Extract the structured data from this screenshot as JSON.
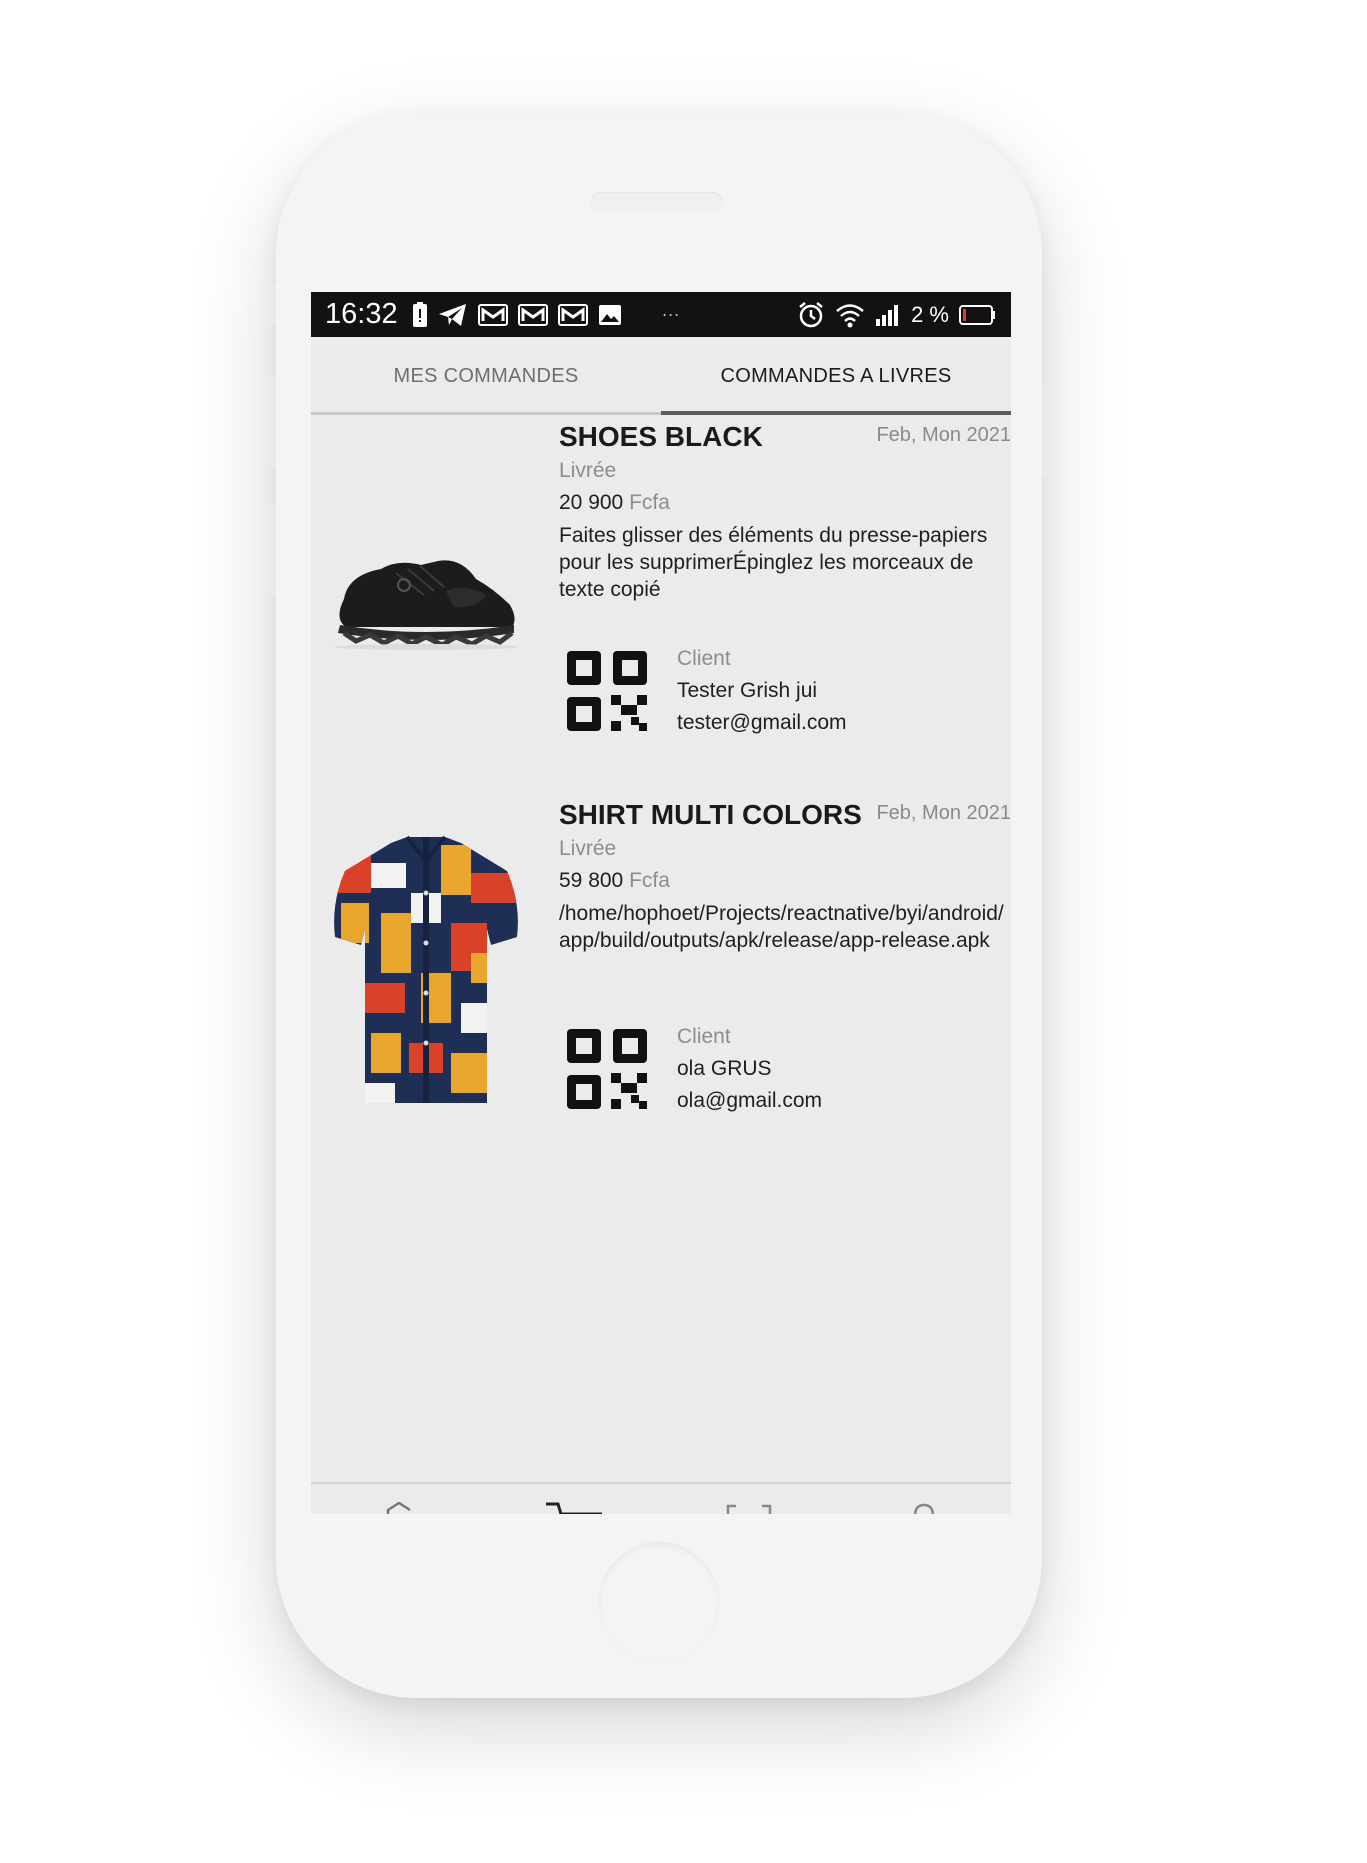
{
  "statusbar": {
    "time": "16:32",
    "battery_text": "2 %",
    "more_dots": "···"
  },
  "tabs": [
    {
      "label": "MES COMMANDES",
      "active": false
    },
    {
      "label": "COMMANDES A LIVRES",
      "active": true
    }
  ],
  "orders": [
    {
      "name": "SHOES BLACK",
      "date": "Feb, Mon 2021",
      "status": "Livrée",
      "price": "20 900",
      "currency": "Fcfa",
      "description": "Faites glisser des éléments du presse-papiers pour les supprimerÉpinglez les morceaux de texte copié",
      "client_label": "Client",
      "client_name": "Tester Grish jui",
      "client_email": "tester@gmail.com",
      "image": "black-shoe-image"
    },
    {
      "name": "SHIRT MULTI COLORS",
      "date": "Feb, Mon 2021",
      "status": "Livrée",
      "price": "59 800",
      "currency": "Fcfa",
      "description": "/home/hophoet/Projects/reactnative/byi/android/app/build/outputs/apk/release/app-release.apk",
      "client_label": "Client",
      "client_name": "ola GRUS",
      "client_email": "ola@gmail.com",
      "image": "multicolor-shirt-image"
    }
  ],
  "bottom_nav": [
    "home-icon",
    "cart-icon",
    "scan-icon",
    "profile-icon"
  ],
  "colors": {
    "screen_bg": "#ebebeb",
    "statusbar_bg": "#121212",
    "tab_indicator": "#5c5c5c",
    "muted_text": "#8d8d8d"
  }
}
